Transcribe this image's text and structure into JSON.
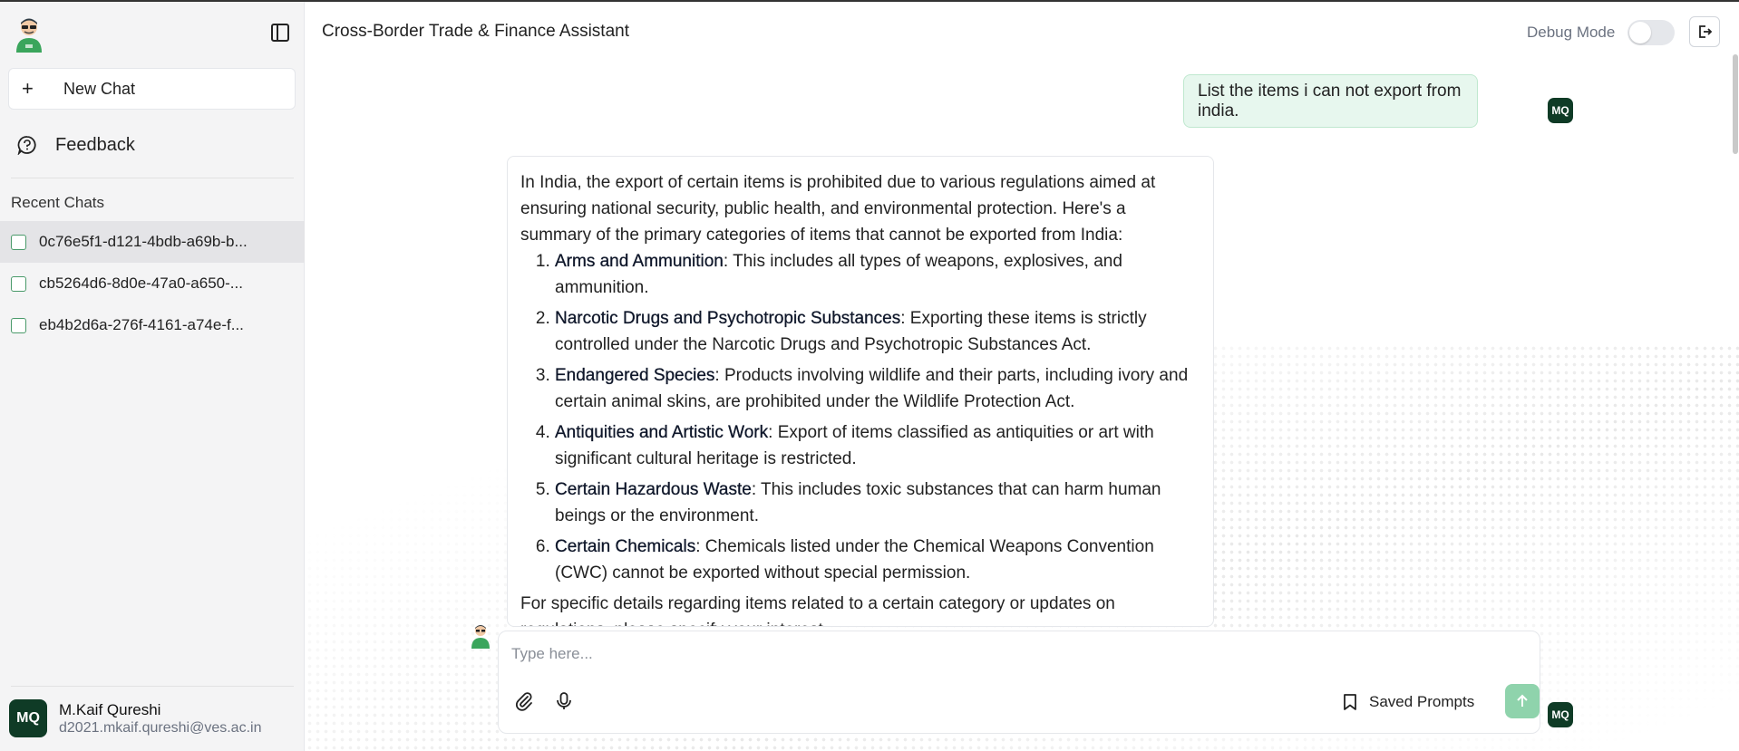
{
  "sidebar": {
    "new_chat_label": "New Chat",
    "feedback_label": "Feedback",
    "recent_title": "Recent Chats",
    "chats": [
      {
        "label": "0c76e5f1-d121-4bdb-a69b-b..."
      },
      {
        "label": "cb5264d6-8d0e-47a0-a650-..."
      },
      {
        "label": "eb4b2d6a-276f-4161-a74e-f..."
      }
    ],
    "user": {
      "initials": "MQ",
      "name": "M.Kaif Qureshi",
      "email": "d2021.mkaif.qureshi@ves.ac.in"
    }
  },
  "header": {
    "title": "Cross-Border Trade & Finance Assistant",
    "debug_label": "Debug Mode",
    "debug_on": false
  },
  "conversation": {
    "user_message": "List the items i can not export from india.",
    "user_initials": "MQ",
    "bot": {
      "intro": "In India, the export of certain items is prohibited due to various regulations aimed at ensuring national security, public health, and environmental protection. Here's a summary of the primary categories of items that cannot be exported from India:",
      "items": [
        {
          "term": "Arms and Ammunition",
          "text": ": This includes all types of weapons, explosives, and ammunition."
        },
        {
          "term": "Narcotic Drugs and Psychotropic Substances",
          "text": ": Exporting these items is strictly controlled under the Narcotic Drugs and Psychotropic Substances Act."
        },
        {
          "term": "Endangered Species",
          "text": ": Products involving wildlife and their parts, including ivory and certain animal skins, are prohibited under the Wildlife Protection Act."
        },
        {
          "term": "Antiquities and Artistic Work",
          "text": ": Export of items classified as antiquities or art with significant cultural heritage is restricted."
        },
        {
          "term": "Certain Hazardous Waste",
          "text": ": This includes toxic substances that can harm human beings or the environment."
        },
        {
          "term": "Certain Chemicals",
          "text": ": Chemicals listed under the Chemical Weapons Convention (CWC) cannot be exported without special permission."
        }
      ],
      "outro": "For specific details regarding items related to a certain category or updates on regulations, please specify your interest."
    }
  },
  "composer": {
    "placeholder": "Type here...",
    "saved_prompts_label": "Saved Prompts",
    "initials": "MQ"
  },
  "colors": {
    "accent_dark": "#0f3b26",
    "user_bubble": "#e7f7ee",
    "send_button": "#8fd3ac"
  },
  "icons": {
    "logo": "assistant-avatar-icon",
    "sidebar_toggle": "sidebar-panel-icon",
    "new_chat": "plus-icon",
    "feedback": "chat-feedback-icon",
    "logout": "logout-icon",
    "attach": "paperclip-icon",
    "mic": "microphone-icon",
    "saved": "bookmark-icon",
    "send": "arrow-up-icon"
  }
}
